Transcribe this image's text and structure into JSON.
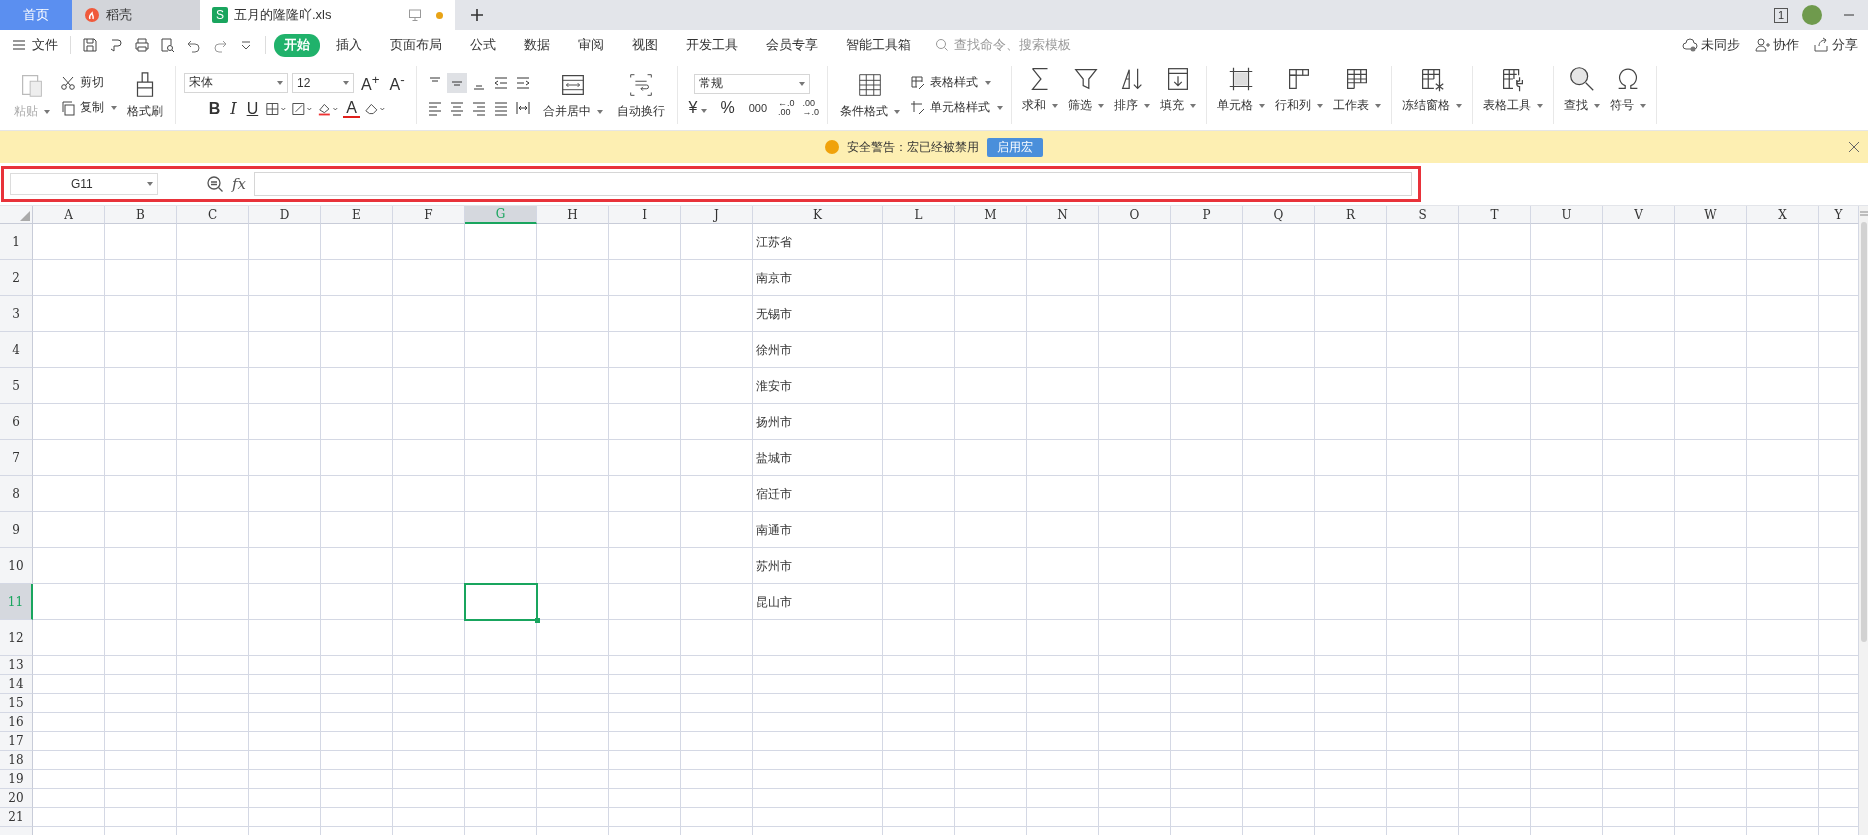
{
  "tab_bar": {
    "tabs": [
      {
        "kind": "home",
        "label": "首页",
        "selected": false
      },
      {
        "kind": "docer",
        "label": "稻壳",
        "selected": false
      },
      {
        "kind": "sheet",
        "label": "五月的隆隆吖.xls",
        "badge": "S",
        "selected": true,
        "unsaved": true
      }
    ],
    "window_count": "1"
  },
  "menu": {
    "file": "文件",
    "tabs": [
      {
        "label": "开始",
        "selected": true
      },
      {
        "label": "插入",
        "selected": false
      },
      {
        "label": "页面布局",
        "selected": false
      },
      {
        "label": "公式",
        "selected": false
      },
      {
        "label": "数据",
        "selected": false
      },
      {
        "label": "审阅",
        "selected": false
      },
      {
        "label": "视图",
        "selected": false
      },
      {
        "label": "开发工具",
        "selected": false
      },
      {
        "label": "会员专享",
        "selected": false
      },
      {
        "label": "智能工具箱",
        "selected": false
      }
    ],
    "search": {
      "placeholder": "查找命令、搜索模板"
    },
    "actions": [
      "未同步",
      "协作",
      "分享"
    ]
  },
  "ribbon": {
    "paste": "粘贴",
    "cut": "剪切",
    "copy": "复制",
    "format_painter": "格式刷",
    "font_name": "宋体",
    "font_size": "12",
    "grow_font": "A$^{+}$",
    "shrink_font": "A$^{-}$",
    "bold": "B",
    "italic": "I",
    "underline": "U",
    "font_color": "A",
    "align_top": [
      {
        "selected": false
      },
      {
        "selected": true
      },
      {
        "selected": false
      },
      {
        "selected": false
      },
      {
        "selected": false
      }
    ],
    "merge_center": "合并居中",
    "wrap_text": "自动换行",
    "number_format": "常规",
    "currency": "¥",
    "percent": "%",
    "thousands": "000",
    "increase_decimal": [
      "←.0",
      ".00"
    ],
    "decrease_decimal": [
      ".00",
      "→.0"
    ],
    "conditional_format": "条件格式",
    "table_style": "表格样式",
    "cell_style": "单元格样式",
    "tools": [
      "求和",
      "筛选",
      "排序",
      "填充",
      "单元格",
      "行和列",
      "工作表",
      "冻结窗格",
      "表格工具",
      "查找",
      "符号"
    ]
  },
  "warning": {
    "text": "安全警告：宏已经被禁用",
    "button": "启用宏"
  },
  "formula_bar": {
    "cell_ref": "G11",
    "fx": "fx",
    "highlighted": true
  },
  "sheet": {
    "columns": [
      {
        "label": "A",
        "selected": false
      },
      {
        "label": "B",
        "selected": false
      },
      {
        "label": "C",
        "selected": false
      },
      {
        "label": "D",
        "selected": false
      },
      {
        "label": "E",
        "selected": false
      },
      {
        "label": "F",
        "selected": false
      },
      {
        "label": "G",
        "selected": true
      },
      {
        "label": "H",
        "selected": false
      },
      {
        "label": "I",
        "selected": false
      },
      {
        "label": "J",
        "selected": false
      },
      {
        "label": "K",
        "selected": false,
        "cells": [
          "江苏省",
          "南京市",
          "无锡市",
          "徐州市",
          "淮安市",
          "扬州市",
          "盐城市",
          "宿迁市",
          "南通市",
          "苏州市",
          "昆山市"
        ]
      },
      {
        "label": "L",
        "selected": false
      },
      {
        "label": "M",
        "selected": false
      },
      {
        "label": "N",
        "selected": false
      },
      {
        "label": "O",
        "selected": false
      },
      {
        "label": "P",
        "selected": false
      },
      {
        "label": "Q",
        "selected": false
      },
      {
        "label": "R",
        "selected": false
      },
      {
        "label": "S",
        "selected": false
      },
      {
        "label": "T",
        "selected": false
      },
      {
        "label": "U",
        "selected": false
      },
      {
        "label": "V",
        "selected": false
      },
      {
        "label": "W",
        "selected": false
      },
      {
        "label": "X",
        "selected": false
      },
      {
        "label": "Y",
        "selected": false
      }
    ],
    "rows": [
      {
        "label": "1",
        "selected": false
      },
      {
        "label": "2",
        "selected": false
      },
      {
        "label": "3",
        "selected": false
      },
      {
        "label": "4",
        "selected": false
      },
      {
        "label": "5",
        "selected": false
      },
      {
        "label": "6",
        "selected": false
      },
      {
        "label": "7",
        "selected": false
      },
      {
        "label": "8",
        "selected": false
      },
      {
        "label": "9",
        "selected": false
      },
      {
        "label": "10",
        "selected": false
      },
      {
        "label": "11",
        "selected": true
      },
      {
        "label": "12",
        "selected": false
      },
      {
        "label": "13",
        "selected": false
      },
      {
        "label": "14",
        "selected": false
      },
      {
        "label": "15",
        "selected": false
      },
      {
        "label": "16",
        "selected": false
      },
      {
        "label": "17",
        "selected": false
      },
      {
        "label": "18",
        "selected": false
      },
      {
        "label": "19",
        "selected": false
      },
      {
        "label": "20",
        "selected": false
      },
      {
        "label": "21",
        "selected": false
      }
    ]
  }
}
